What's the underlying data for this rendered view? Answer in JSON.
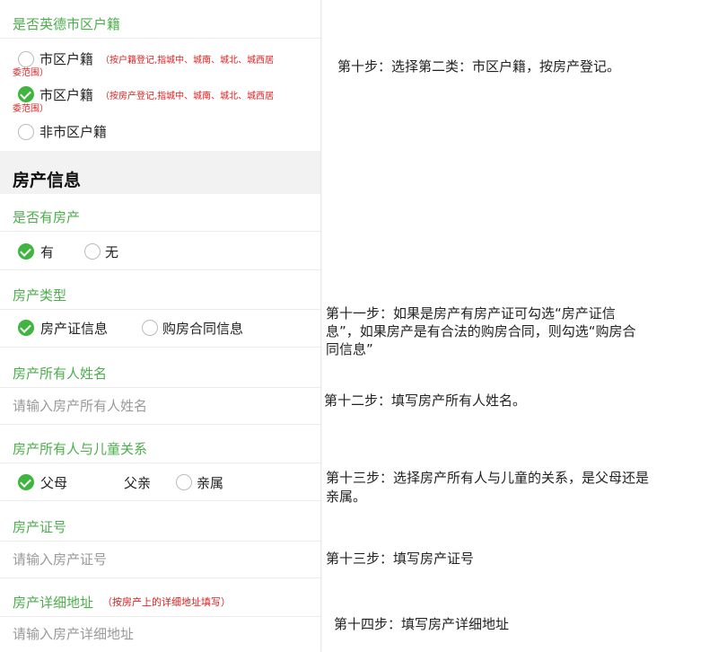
{
  "hukou": {
    "label": "是否英德市区户籍",
    "option1": {
      "text": "市区户籍",
      "note1": "（按户籍登记,指城中、城南、城北、城西居",
      "note2": "委范围）"
    },
    "option2": {
      "text": "市区户籍",
      "note1": "（按房产登记,指城中、城南、城北、城西居",
      "note2": "委范围）"
    },
    "option3": {
      "text": "非市区户籍"
    }
  },
  "section": {
    "title": "房产信息"
  },
  "has_property": {
    "label": "是否有房产",
    "yes": "有",
    "no": "无"
  },
  "property_type": {
    "label": "房产类型",
    "opt1": "房产证信息",
    "opt2": "购房合同信息"
  },
  "owner_name": {
    "label": "房产所有人姓名",
    "placeholder": "请输入房产所有人姓名"
  },
  "relation": {
    "label": "房产所有人与儿童关系",
    "opt1": "父母",
    "mid": "父亲",
    "opt2": "亲属"
  },
  "cert_no": {
    "label": "房产证号",
    "placeholder": "请输入房产证号"
  },
  "address": {
    "label": "房产详细地址",
    "note": "（按房产上的详细地址填写）",
    "placeholder": "请输入房产详细地址"
  },
  "steps": {
    "s10": "第十步：选择第二类：市区户籍，按房产登记。",
    "s11_l1": "第十一步：如果是房产有房产证可勾选“房产证信",
    "s11_l2": "息”，如果房产是有合法的购房合同，则勾选“购房合",
    "s11_l3": "同信息”",
    "s12": "第十二步：填写房产所有人姓名。",
    "s13a_l1": "第十三步：选择房产所有人与儿童的关系，是父母还是",
    "s13a_l2": "亲属。",
    "s13b": "第十三步：填写房产证号",
    "s14": "第十四步：填写房产详细地址"
  }
}
